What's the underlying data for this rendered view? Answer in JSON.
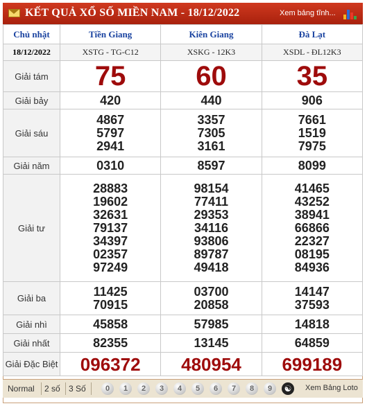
{
  "header": {
    "title": "KẾT QUẢ XỔ SỐ MIỀN NAM - 18/12/2022",
    "view_link": "Xem bảng tĩnh..."
  },
  "table": {
    "day": "Chủ nhật",
    "date": "18/12/2022",
    "provinces": [
      "Tiền Giang",
      "Kiên Giang",
      "Đà Lạt"
    ],
    "codes": [
      "XSTG - TG-C12",
      "XSKG - 12K3",
      "XSDL - ĐL12K3"
    ],
    "prizes": {
      "g8": {
        "label": "Giải tám",
        "values": [
          "75",
          "60",
          "35"
        ]
      },
      "g7": {
        "label": "Giải bảy",
        "values": [
          "420",
          "440",
          "906"
        ]
      },
      "g6": {
        "label": "Giải sáu",
        "values": [
          [
            "4867",
            "5797",
            "2941"
          ],
          [
            "3357",
            "7305",
            "3161"
          ],
          [
            "7661",
            "1519",
            "7975"
          ]
        ]
      },
      "g5": {
        "label": "Giải năm",
        "values": [
          "0310",
          "8597",
          "8099"
        ]
      },
      "g4": {
        "label": "Giải tư",
        "values": [
          [
            "28883",
            "19602",
            "32631",
            "79137",
            "34397",
            "02357",
            "97249"
          ],
          [
            "98154",
            "77411",
            "29353",
            "34116",
            "93806",
            "89787",
            "49418"
          ],
          [
            "41465",
            "43252",
            "38941",
            "66866",
            "22327",
            "08195",
            "84936"
          ]
        ]
      },
      "g3": {
        "label": "Giải ba",
        "values": [
          [
            "11425",
            "70915"
          ],
          [
            "03700",
            "20858"
          ],
          [
            "14147",
            "37593"
          ]
        ]
      },
      "g2": {
        "label": "Giải nhì",
        "values": [
          "45858",
          "57985",
          "14818"
        ]
      },
      "g1": {
        "label": "Giải nhất",
        "values": [
          "82355",
          "13145",
          "64859"
        ]
      },
      "db": {
        "label": "Giải Đặc Biệt",
        "values": [
          "096372",
          "480954",
          "699189"
        ]
      }
    }
  },
  "footer": {
    "modes": [
      "Normal",
      "2 số",
      "3 Số"
    ],
    "digits": [
      "0",
      "1",
      "2",
      "3",
      "4",
      "5",
      "6",
      "7",
      "8",
      "9"
    ],
    "loto_link": "Xem Bảng Loto"
  },
  "colors": {
    "header_bg": "#b82a14",
    "prize_red": "#9e0b0b",
    "province_blue": "#1a43a0"
  }
}
